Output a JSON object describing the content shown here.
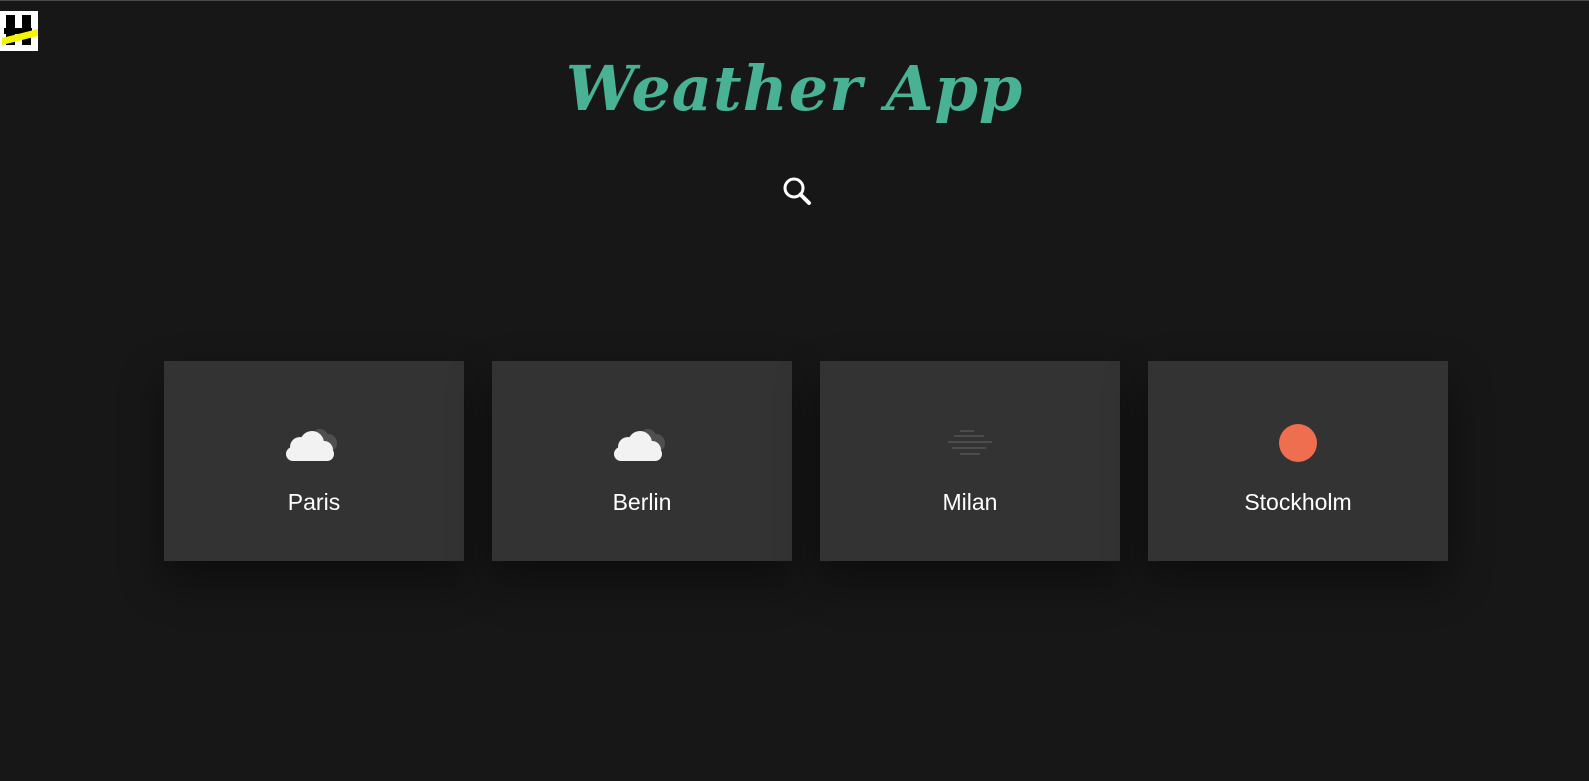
{
  "app": {
    "title": "Weather App"
  },
  "logo": {
    "icon": "logo-mark",
    "colors": {
      "background": "#ffffff",
      "mark": "#000000",
      "stripe": "#f5f500"
    }
  },
  "search": {
    "icon": "search-icon",
    "color": "#ffffff"
  },
  "theme": {
    "background": "#171717",
    "card_background": "#333333",
    "accent": "#49b294",
    "sun": "#ef6e4f"
  },
  "cities": [
    {
      "name": "Paris",
      "condition_icon": "cloudy-icon"
    },
    {
      "name": "Berlin",
      "condition_icon": "cloudy-icon"
    },
    {
      "name": "Milan",
      "condition_icon": "fog-icon"
    },
    {
      "name": "Stockholm",
      "condition_icon": "sun-icon"
    }
  ]
}
